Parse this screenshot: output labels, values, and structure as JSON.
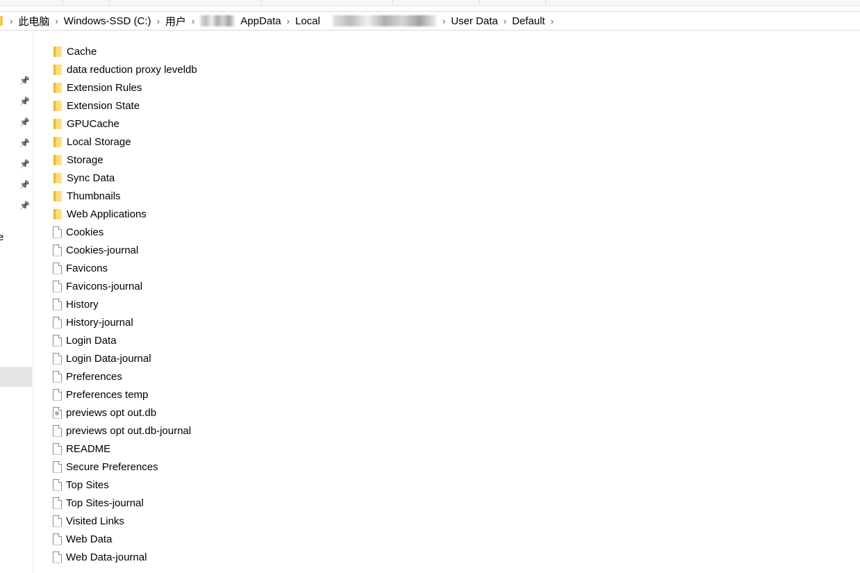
{
  "breadcrumb": [
    "此电脑",
    "Windows-SSD (C:)",
    "用户",
    "AppData",
    "Local",
    "User Data",
    "Default"
  ],
  "items": [
    {
      "name": "Cache",
      "type": "folder"
    },
    {
      "name": "data reduction proxy leveldb",
      "type": "folder"
    },
    {
      "name": "Extension Rules",
      "type": "folder"
    },
    {
      "name": "Extension State",
      "type": "folder"
    },
    {
      "name": "GPUCache",
      "type": "folder"
    },
    {
      "name": "Local Storage",
      "type": "folder"
    },
    {
      "name": "Storage",
      "type": "folder"
    },
    {
      "name": "Sync Data",
      "type": "folder"
    },
    {
      "name": "Thumbnails",
      "type": "folder"
    },
    {
      "name": "Web Applications",
      "type": "folder"
    },
    {
      "name": "Cookies",
      "type": "file"
    },
    {
      "name": "Cookies-journal",
      "type": "file"
    },
    {
      "name": "Favicons",
      "type": "file"
    },
    {
      "name": "Favicons-journal",
      "type": "file"
    },
    {
      "name": "History",
      "type": "file"
    },
    {
      "name": "History-journal",
      "type": "file"
    },
    {
      "name": "Login Data",
      "type": "file"
    },
    {
      "name": "Login Data-journal",
      "type": "file"
    },
    {
      "name": "Preferences",
      "type": "file"
    },
    {
      "name": "Preferences temp",
      "type": "file"
    },
    {
      "name": "previews opt out.db",
      "type": "db"
    },
    {
      "name": "previews opt out.db-journal",
      "type": "file"
    },
    {
      "name": "README",
      "type": "file"
    },
    {
      "name": "Secure Preferences",
      "type": "file"
    },
    {
      "name": "Top Sites",
      "type": "file"
    },
    {
      "name": "Top Sites-journal",
      "type": "file"
    },
    {
      "name": "Visited Links",
      "type": "file"
    },
    {
      "name": "Web Data",
      "type": "file"
    },
    {
      "name": "Web Data-journal",
      "type": "file"
    }
  ],
  "nav": {
    "partial_label": "e"
  }
}
